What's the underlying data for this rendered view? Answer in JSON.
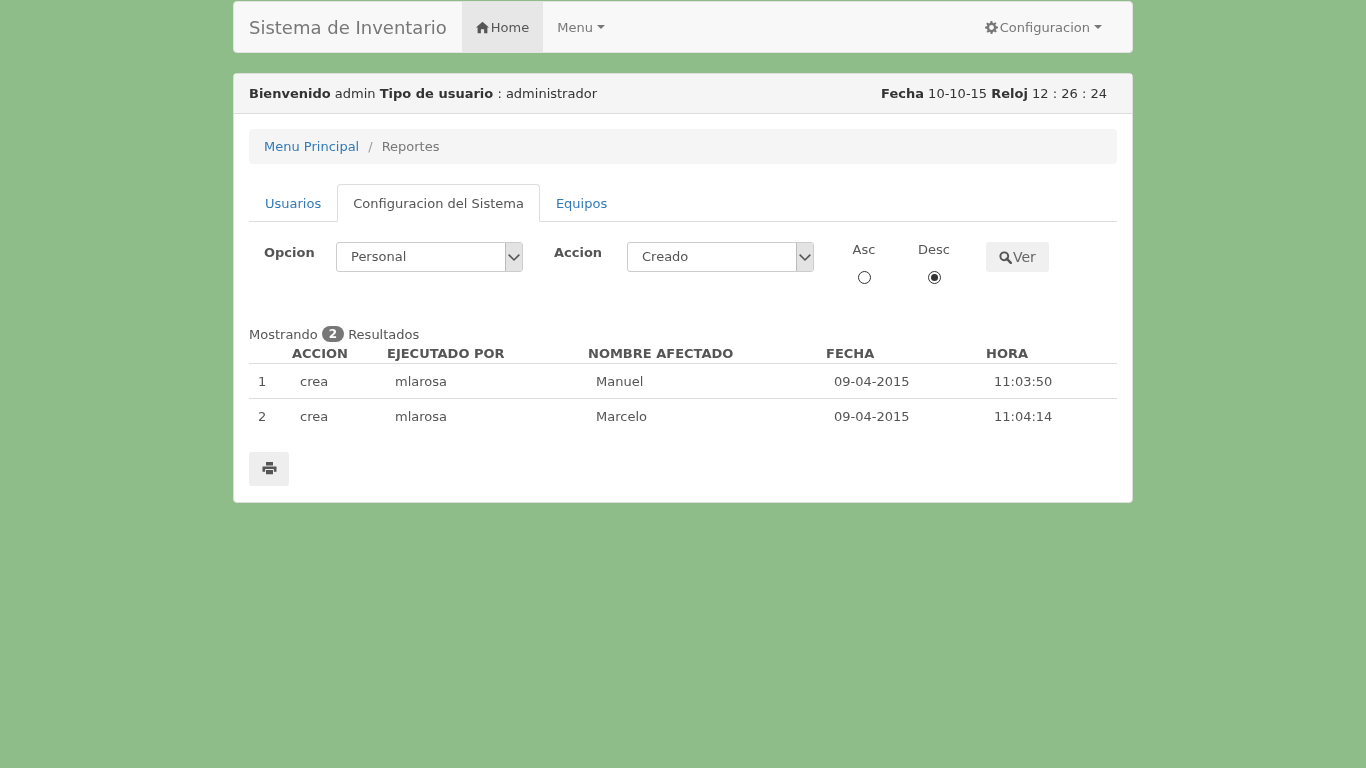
{
  "navbar": {
    "brand": "Sistema de Inventario",
    "items": [
      {
        "label": "Home",
        "kind": "home",
        "dropdown": false,
        "selected": true
      },
      {
        "label": "Menu",
        "kind": "plain",
        "dropdown": true,
        "selected": false
      }
    ],
    "right_item": {
      "label": "Configuracion",
      "kind": "settings",
      "dropdown": true
    }
  },
  "panel_header": {
    "welcome": "**Bienvenido** admin **Tipo de usuario** : administrador",
    "clock": "**Fecha** 10-10-15 **Reloj** 12 : 26 : 24"
  },
  "breadcrumb": {
    "separator": "/",
    "items": [
      {
        "label": "Menu Principal",
        "link": true
      },
      {
        "label": "Reportes",
        "link": false
      }
    ]
  },
  "tabs": [
    {
      "label": "Usuarios",
      "selected": false
    },
    {
      "label": "Configuracion del Sistema",
      "selected": true
    },
    {
      "label": "Equipos",
      "selected": false
    }
  ],
  "filters": {
    "option": {
      "label": "Opcion",
      "value": "Personal"
    },
    "action": {
      "label": "Accion",
      "value": "Creado"
    },
    "order": [
      {
        "label": "Asc",
        "selected": false
      },
      {
        "label": "Desc",
        "selected": true
      }
    ],
    "button": "Ver"
  },
  "results": {
    "prefix": "Mostrando",
    "count": "2",
    "suffix": "Resultados"
  },
  "table": {
    "columns": [
      "ACCION",
      "EJECUTADO POR",
      "NOMBRE AFECTADO",
      "FECHA",
      "HORA"
    ],
    "rows": [
      {
        "number": "1",
        "cells": [
          "crea",
          "mlarosa",
          "Manuel",
          "09-04-2015",
          "11:03:50"
        ]
      },
      {
        "number": "2",
        "cells": [
          "crea",
          "mlarosa",
          "Marcelo",
          "09-04-2015",
          "11:04:14"
        ]
      }
    ]
  }
}
